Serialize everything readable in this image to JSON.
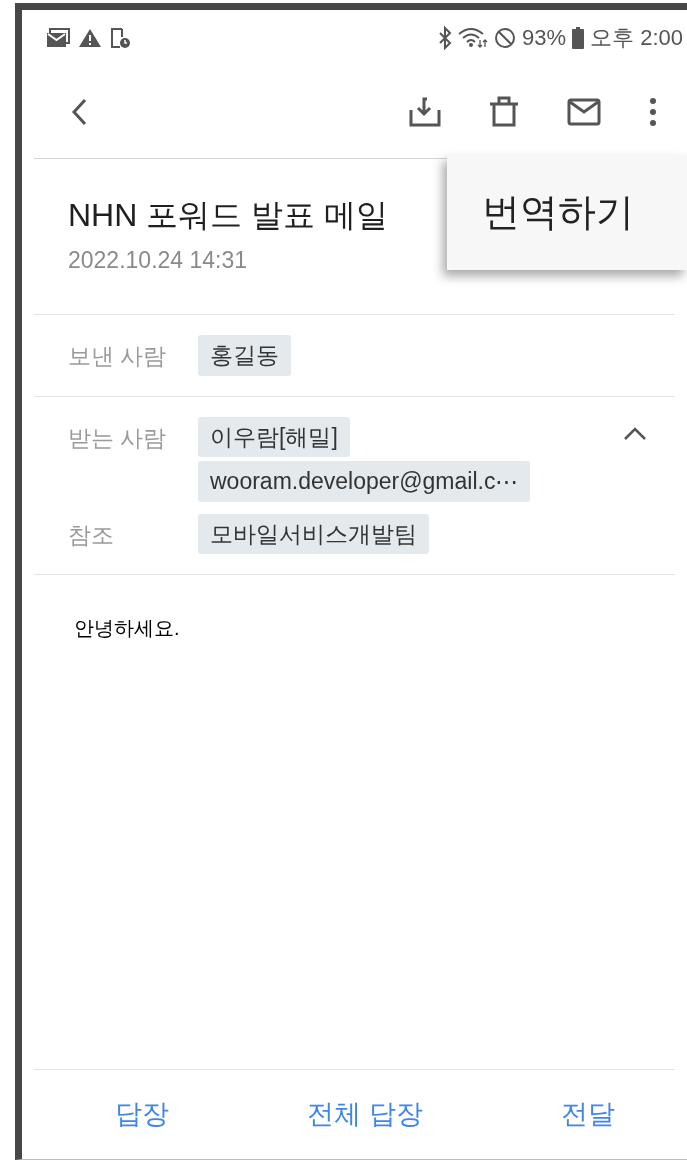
{
  "status_bar": {
    "battery": "93%",
    "time": "오후 2:00"
  },
  "email": {
    "subject": "NHN 포워드 발표 메일",
    "date": "2022.10.24 14:31",
    "fields": [
      {
        "label": "보낸 사람",
        "chips": [
          "홍길동"
        ]
      },
      {
        "label": "받는 사람",
        "chips": [
          "이우람[해밀]",
          "wooram.developer@gmail.c⋯"
        ],
        "expanded": true
      },
      {
        "label": "참조",
        "chips": [
          "모바일서비스개발팀"
        ]
      }
    ],
    "body": "안녕하세요."
  },
  "actions": [
    "답장",
    "전체 답장",
    "전달"
  ],
  "popup_menu": {
    "items": [
      "번역하기"
    ]
  }
}
